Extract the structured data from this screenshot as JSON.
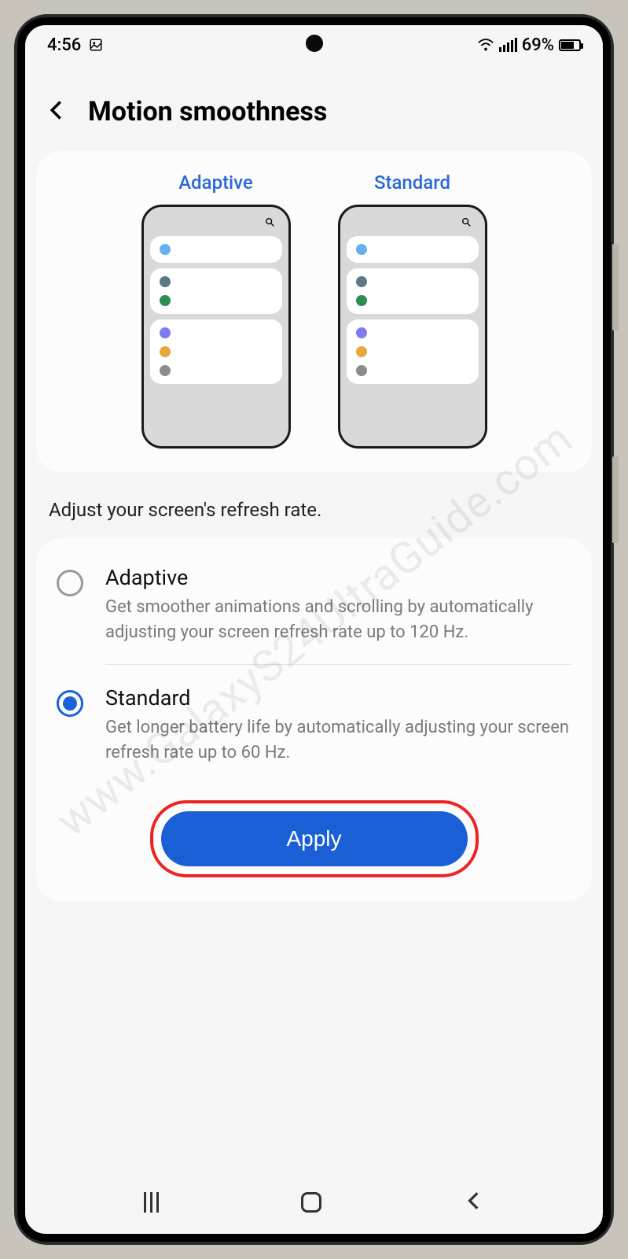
{
  "status": {
    "time": "4:56",
    "battery_pct": "69%"
  },
  "header": {
    "title": "Motion smoothness"
  },
  "preview": {
    "adaptive_label": "Adaptive",
    "standard_label": "Standard"
  },
  "description": "Adjust your screen's refresh rate.",
  "options": [
    {
      "title": "Adaptive",
      "desc": "Get smoother animations and scrolling by automatically adjusting your screen refresh rate up to 120 Hz.",
      "selected": false
    },
    {
      "title": "Standard",
      "desc": "Get longer battery life by automatically adjusting your screen refresh rate up to 60 Hz.",
      "selected": true
    }
  ],
  "apply_label": "Apply",
  "watermark": "www.GalaxyS24UltraGuide.com"
}
